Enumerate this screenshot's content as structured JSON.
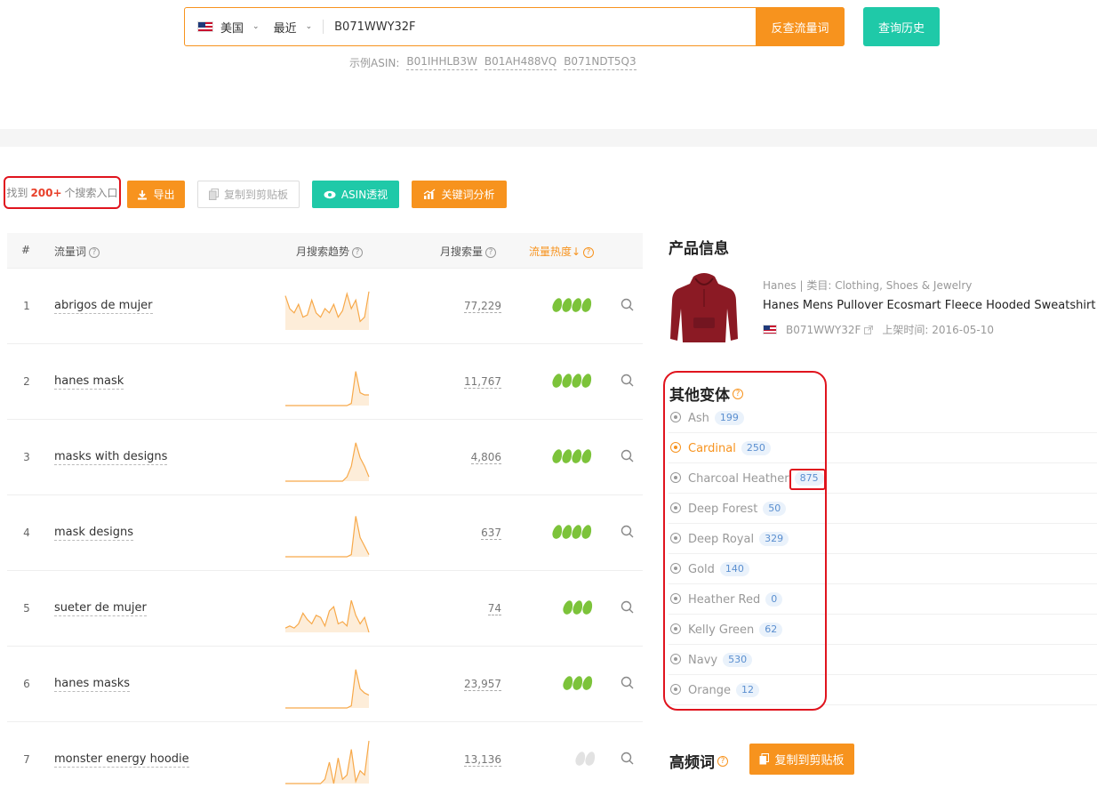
{
  "search": {
    "country": "美国",
    "period": "最近",
    "asin": "B071WWY32F",
    "submit_label": "反查流量词",
    "history_label": "查询历史",
    "examples_label": "示例ASIN:",
    "examples": [
      "B01IHHLB3W",
      "B01AH488VQ",
      "B071NDT5Q3"
    ]
  },
  "toolbar": {
    "found_prefix": "找到",
    "found_count": "200+",
    "found_suffix": "个搜索入口",
    "export_label": "导出",
    "copy_label": "复制到剪贴板",
    "asin_label": "ASIN透视",
    "kw_analysis_label": "关键词分析"
  },
  "table": {
    "headers": {
      "index": "#",
      "keyword": "流量词",
      "trend": "月搜索趋势",
      "volume": "月搜索量",
      "heat": "流量热度↓"
    },
    "rows": [
      {
        "index": "1",
        "keyword": "abrigos de mujer",
        "volume": "77,229",
        "heat": 4,
        "trend": [
          0.8,
          0.5,
          0.4,
          0.6,
          0.3,
          0.35,
          0.7,
          0.4,
          0.3,
          0.5,
          0.4,
          0.6,
          0.3,
          0.45,
          0.85,
          0.5,
          0.7,
          0.2,
          0.3,
          0.9
        ]
      },
      {
        "index": "2",
        "keyword": "hanes mask",
        "volume": "11,767",
        "heat": 4,
        "trend": [
          0,
          0,
          0,
          0,
          0,
          0,
          0,
          0,
          0,
          0,
          0,
          0,
          0,
          0,
          0,
          0.05,
          0.8,
          0.3,
          0.25,
          0.25
        ]
      },
      {
        "index": "3",
        "keyword": "masks with designs",
        "volume": "4,806",
        "heat": 4,
        "trend": [
          0,
          0,
          0,
          0,
          0,
          0,
          0,
          0,
          0,
          0,
          0,
          0,
          0,
          0,
          0.1,
          0.35,
          0.9,
          0.55,
          0.35,
          0.1
        ]
      },
      {
        "index": "4",
        "keyword": "mask designs",
        "volume": "637",
        "heat": 4,
        "trend": [
          0,
          0,
          0,
          0,
          0,
          0,
          0,
          0,
          0,
          0,
          0,
          0,
          0,
          0,
          0,
          0.05,
          0.95,
          0.45,
          0.25,
          0.05
        ]
      },
      {
        "index": "5",
        "keyword": "sueter de mujer",
        "volume": "74",
        "heat": 3,
        "trend": [
          0.1,
          0.15,
          0.1,
          0.2,
          0.45,
          0.3,
          0.2,
          0.4,
          0.35,
          0.15,
          0.5,
          0.6,
          0.2,
          0.25,
          0.15,
          0.75,
          0.4,
          0.2,
          0.35,
          0
        ]
      },
      {
        "index": "6",
        "keyword": "hanes masks",
        "volume": "23,957",
        "heat": 3,
        "trend": [
          0,
          0,
          0,
          0,
          0,
          0,
          0,
          0,
          0,
          0,
          0,
          0,
          0,
          0,
          0,
          0.05,
          0.9,
          0.45,
          0.35,
          0.3
        ]
      },
      {
        "index": "7",
        "keyword": "monster energy hoodie",
        "volume": "13,136",
        "heat": 2,
        "trend": [
          0,
          0,
          0,
          0,
          0,
          0,
          0,
          0,
          0,
          0.1,
          0.5,
          0,
          0.6,
          0.1,
          0.2,
          0.8,
          0.05,
          0.3,
          0.2,
          1
        ]
      }
    ]
  },
  "product": {
    "section_title": "产品信息",
    "brand": "Hanes",
    "category_label": "类目:",
    "category": "Clothing, Shoes & Jewelry",
    "title": "Hanes Mens Pullover Ecosmart Fleece Hooded Sweatshirt",
    "asin": "B071WWY32F",
    "listed_label": "上架时间:",
    "listed_date": "2016-05-10",
    "image_color": "#8b1a24"
  },
  "variants": {
    "title": "其他变体",
    "items": [
      {
        "name": "Ash",
        "count": "199"
      },
      {
        "name": "Cardinal",
        "count": "250"
      },
      {
        "name": "Charcoal Heather",
        "count": "875"
      },
      {
        "name": "Deep Forest",
        "count": "50"
      },
      {
        "name": "Deep Royal",
        "count": "329"
      },
      {
        "name": "Gold",
        "count": "140"
      },
      {
        "name": "Heather Red",
        "count": "0"
      },
      {
        "name": "Kelly Green",
        "count": "62"
      },
      {
        "name": "Navy",
        "count": "530"
      },
      {
        "name": "Orange",
        "count": "12"
      }
    ]
  },
  "high_freq": {
    "title": "高频词",
    "copy_label": "复制到剪贴板"
  },
  "colors": {
    "accent": "#f7931e",
    "teal": "#1fc9a8",
    "leaf": "#7cc33a",
    "highlight": "#e0141e"
  }
}
